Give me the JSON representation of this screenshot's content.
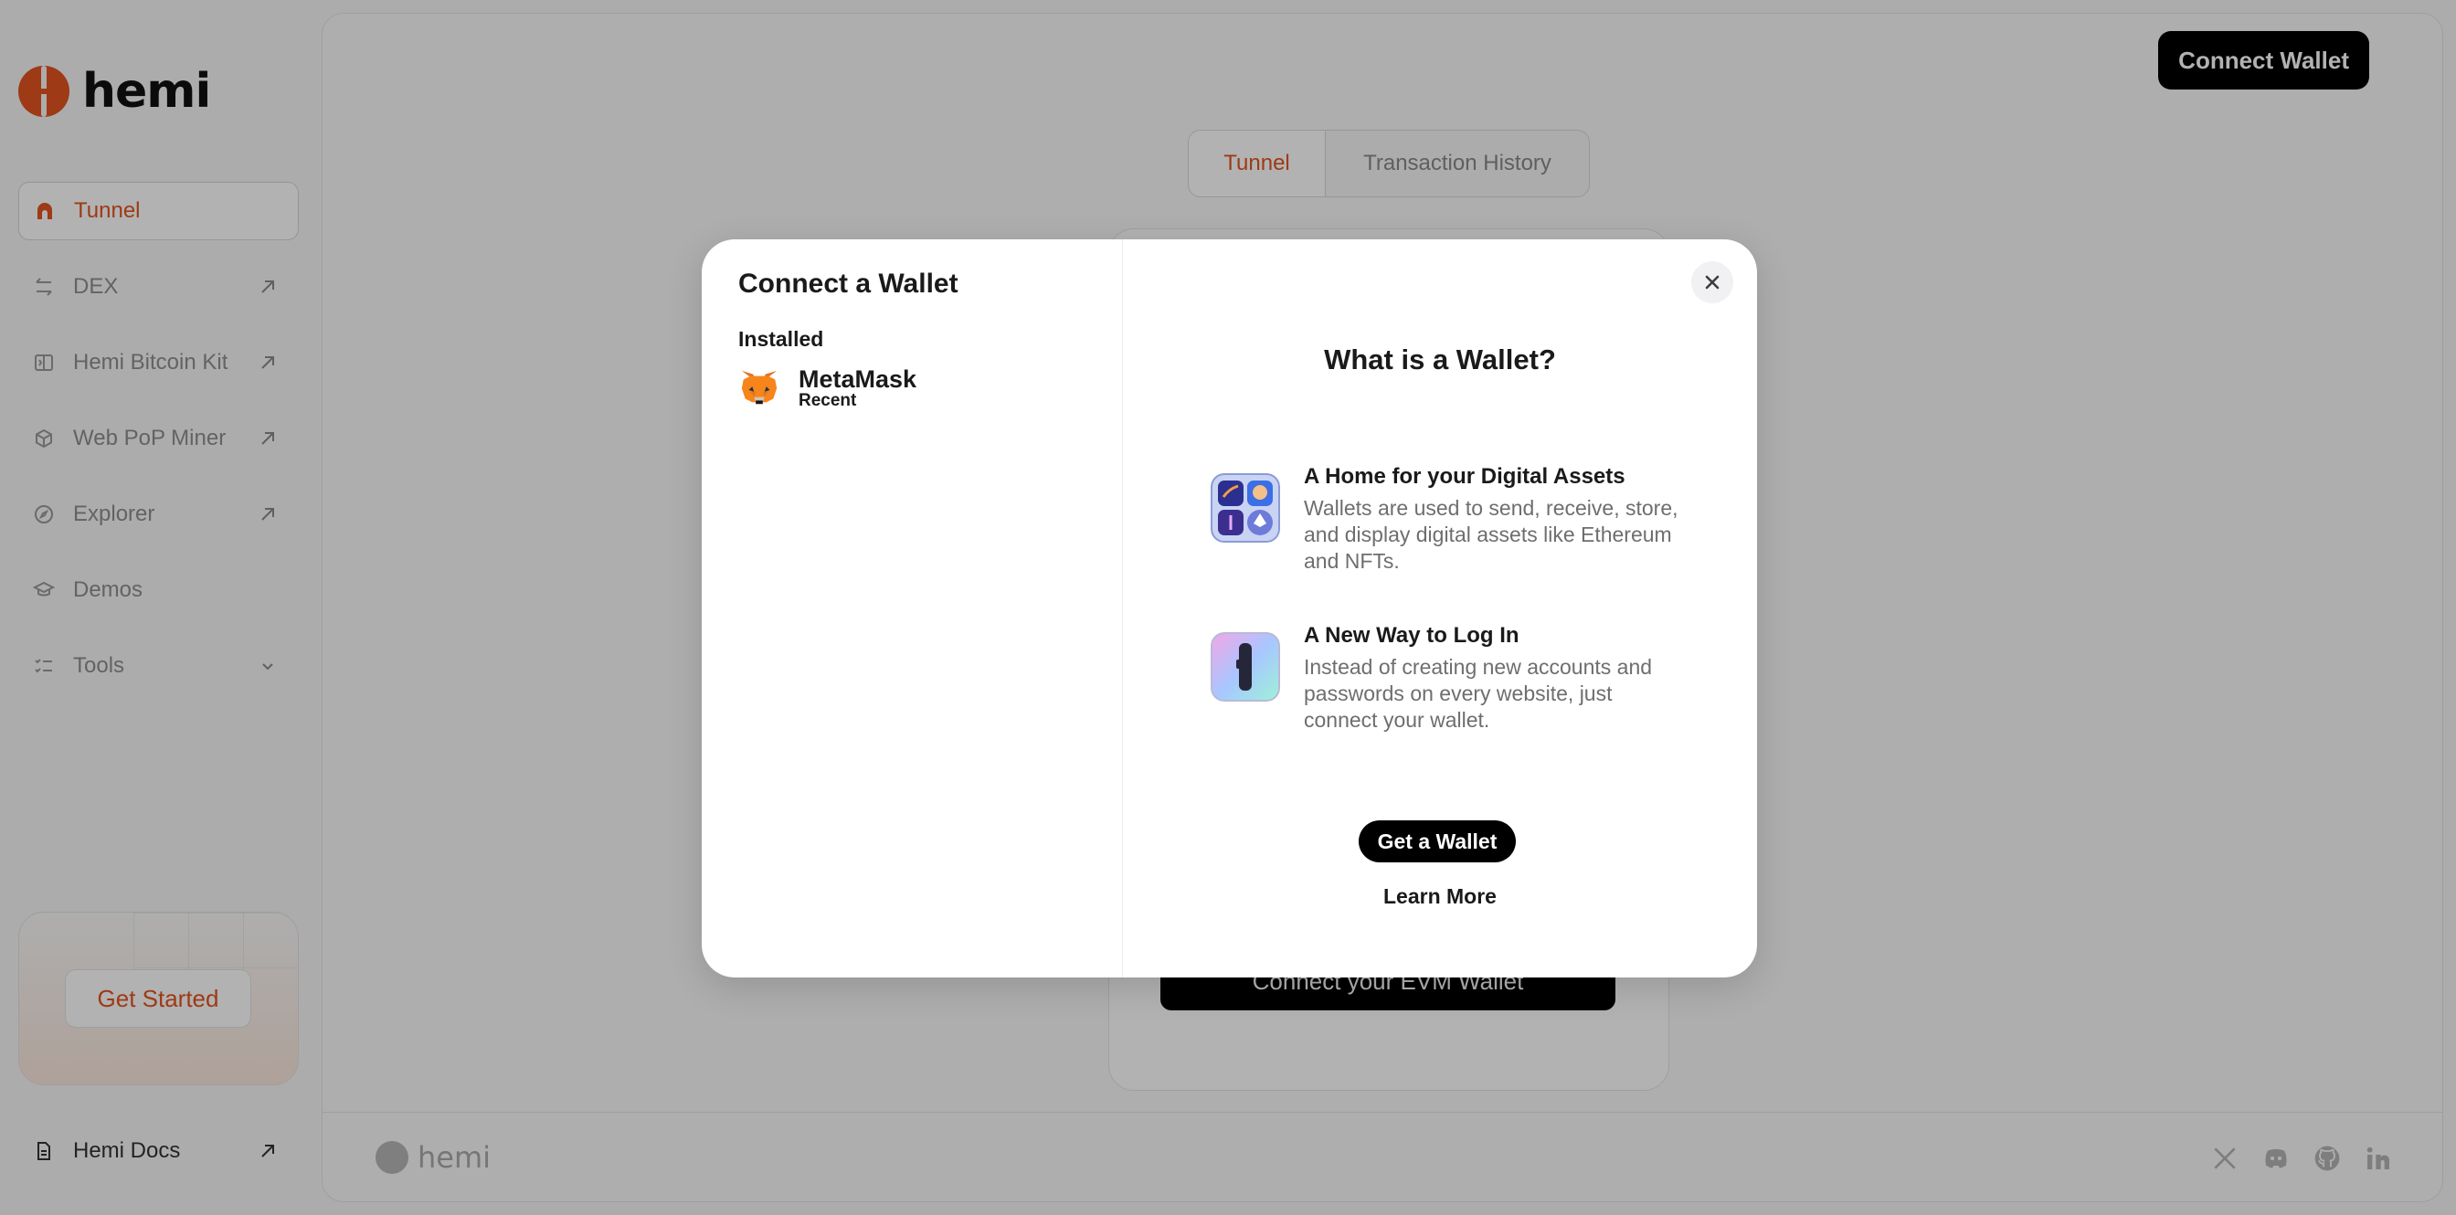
{
  "brand": {
    "name": "hemi",
    "accent": "#e2531f"
  },
  "sidebar": {
    "items": [
      {
        "label": "Tunnel",
        "icon": "tunnel-icon",
        "external": false,
        "active": true
      },
      {
        "label": "DEX",
        "icon": "swap-arrows-icon",
        "external": true,
        "active": false
      },
      {
        "label": "Hemi Bitcoin Kit",
        "icon": "kit-icon",
        "external": true,
        "active": false
      },
      {
        "label": "Web PoP Miner",
        "icon": "cube-icon",
        "external": true,
        "active": false
      },
      {
        "label": "Explorer",
        "icon": "compass-icon",
        "external": true,
        "active": false
      },
      {
        "label": "Demos",
        "icon": "graduation-cap-icon",
        "external": false,
        "active": false
      },
      {
        "label": "Tools",
        "icon": "checklist-icon",
        "external": false,
        "active": false,
        "expandable": true
      }
    ],
    "cta_label": "Get Started",
    "docs_label": "Hemi Docs"
  },
  "header": {
    "connect_label": "Connect Wallet"
  },
  "main": {
    "tabs": [
      {
        "label": "Tunnel"
      },
      {
        "label": "Transaction History"
      }
    ],
    "evm_button_label": "Connect your EVM Wallet"
  },
  "footer": {
    "logo_text": "hemi",
    "socials": [
      "x-icon",
      "discord-icon",
      "github-icon",
      "linkedin-icon"
    ]
  },
  "modal": {
    "title": "Connect a Wallet",
    "installed_label": "Installed",
    "wallet": {
      "name": "MetaMask",
      "tag": "Recent"
    },
    "right_title": "What is a Wallet?",
    "features": [
      {
        "title": "A Home for your Digital Assets",
        "desc": "Wallets are used to send, receive, store, and display digital assets like Ethereum and NFTs."
      },
      {
        "title": "A New Way to Log In",
        "desc": "Instead of creating new accounts and passwords on every website, just connect your wallet."
      }
    ],
    "get_wallet_label": "Get a Wallet",
    "learn_more_label": "Learn More"
  }
}
